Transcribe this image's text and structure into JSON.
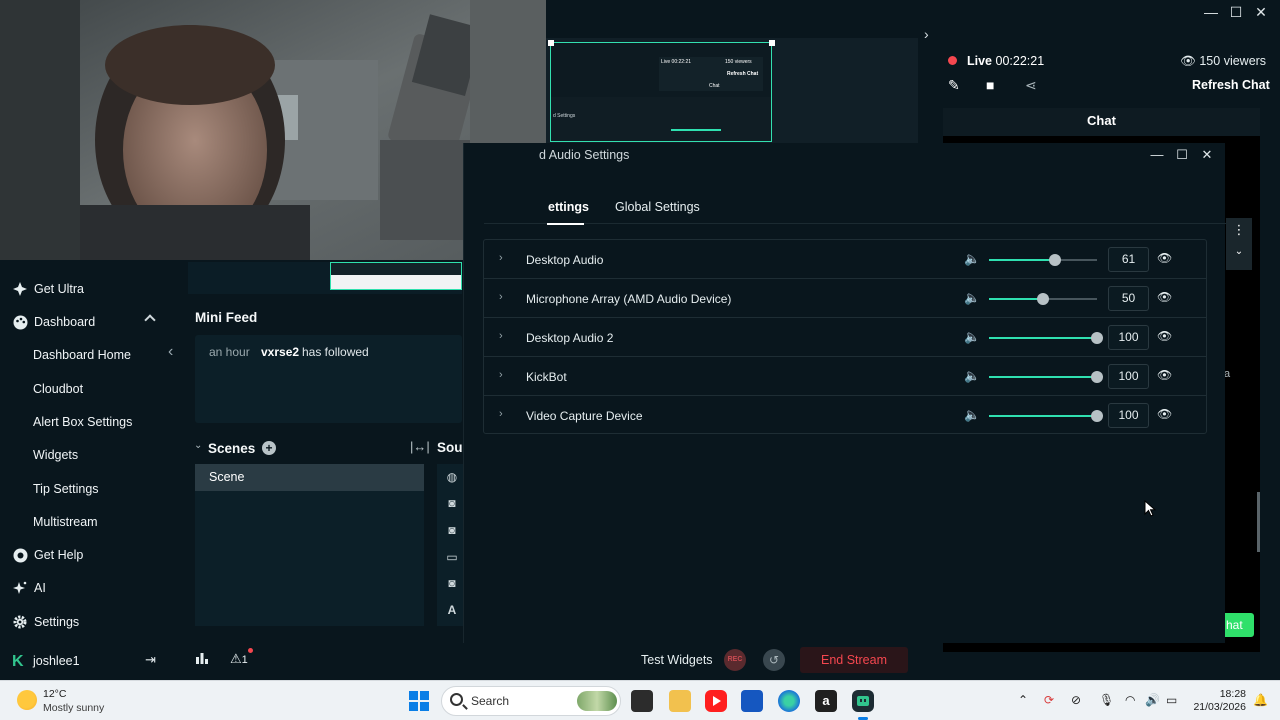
{
  "window": {
    "minimize": "—",
    "maximize": "☐",
    "close": "✕"
  },
  "sidebar": {
    "items": [
      {
        "label": "Get Ultra"
      },
      {
        "label": "Dashboard"
      },
      {
        "label": "Dashboard Home"
      },
      {
        "label": "Cloudbot"
      },
      {
        "label": "Alert Box Settings"
      },
      {
        "label": "Widgets"
      },
      {
        "label": "Tip Settings"
      },
      {
        "label": "Multistream"
      },
      {
        "label": "Get Help"
      },
      {
        "label": "AI"
      },
      {
        "label": "Settings"
      }
    ],
    "user": "joshlee1"
  },
  "mini_feed": {
    "title": "Mini Feed",
    "events": [
      {
        "time": "an hour",
        "user": "vxrse2",
        "action": "has followed"
      }
    ]
  },
  "scenes": {
    "title": "Scenes",
    "items": [
      "Scene"
    ]
  },
  "sources": {
    "title": "Sou"
  },
  "bottom_bar": {
    "test_widgets": "Test Widgets",
    "rec": "REC",
    "end_stream": "End Stream",
    "alert_count": "1"
  },
  "live": {
    "status": "Live",
    "time": "00:22:21",
    "viewers": "150 viewers",
    "refresh_chat": "Refresh Chat"
  },
  "chat": {
    "title": "Chat",
    "button": "hat",
    "side_text": "a"
  },
  "audio_dialog": {
    "title": "d Audio Settings",
    "tabs": [
      "ettings",
      "Global Settings"
    ],
    "sources": [
      {
        "name": "Desktop Audio",
        "volume": "61"
      },
      {
        "name": "Microphone Array (AMD Audio Device)",
        "volume": "50"
      },
      {
        "name": "Desktop Audio 2",
        "volume": "100"
      },
      {
        "name": "KickBot",
        "volume": "100"
      },
      {
        "name": "Video Capture Device",
        "volume": "100"
      }
    ]
  },
  "preview": {
    "mini_live": "Live 00:22:21",
    "mini_viewers": "150 viewers",
    "mini_refresh": "Refresh Chat",
    "mini_chat": "Chat",
    "mini_settings": "d Settings"
  },
  "taskbar": {
    "weather_temp": "12°C",
    "weather_desc": "Mostly sunny",
    "search": "Search",
    "time": "18:28",
    "date": "21/03/2026"
  },
  "colors": {
    "accent": "#2fe0b0",
    "live_red": "#f5474f",
    "background": "#09161d",
    "chat_green": "#2fe06a"
  }
}
